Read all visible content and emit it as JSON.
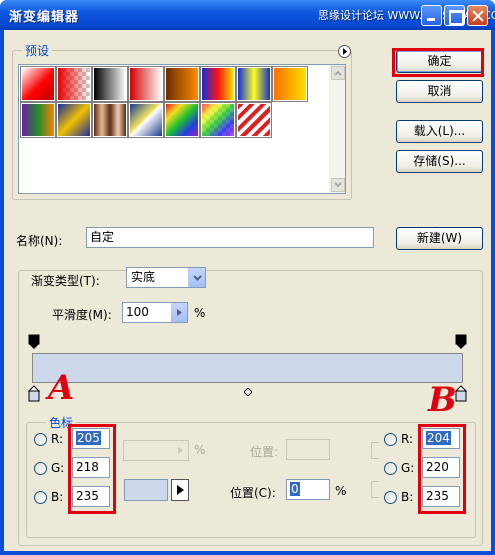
{
  "title": "渐变编辑器",
  "watermark": "思缘设计论坛 WWW.MISSYUAN.COM",
  "presets": {
    "legend": "预设"
  },
  "buttons": {
    "ok": "确定",
    "cancel": "取消",
    "load": "载入(L)...",
    "save": "存储(S)...",
    "new": "新建(W)"
  },
  "name": {
    "label": "名称(N):",
    "value": "自定"
  },
  "gradient_type": {
    "label": "渐变类型(T):",
    "value": "实底"
  },
  "smoothness": {
    "label": "平滑度(M):",
    "value": "100",
    "unit": "%"
  },
  "gradient_bar": {
    "color": "#cdd9eb"
  },
  "stops_group": {
    "legend": "色标",
    "left_rgb": {
      "r_label": "R:",
      "g_label": "G:",
      "b_label": "B:",
      "r": "205",
      "g": "218",
      "b": "235"
    },
    "opacity_unit": "%",
    "position_label_disabled": "位置:",
    "position_label": "位置(C):",
    "position_value": "0",
    "position_unit": "%",
    "right_rgb": {
      "r_label": "R:",
      "g_label": "G:",
      "b_label": "B:",
      "r": "204",
      "g": "220",
      "b": "235"
    }
  },
  "annotations": {
    "left": "A",
    "right": "B"
  }
}
